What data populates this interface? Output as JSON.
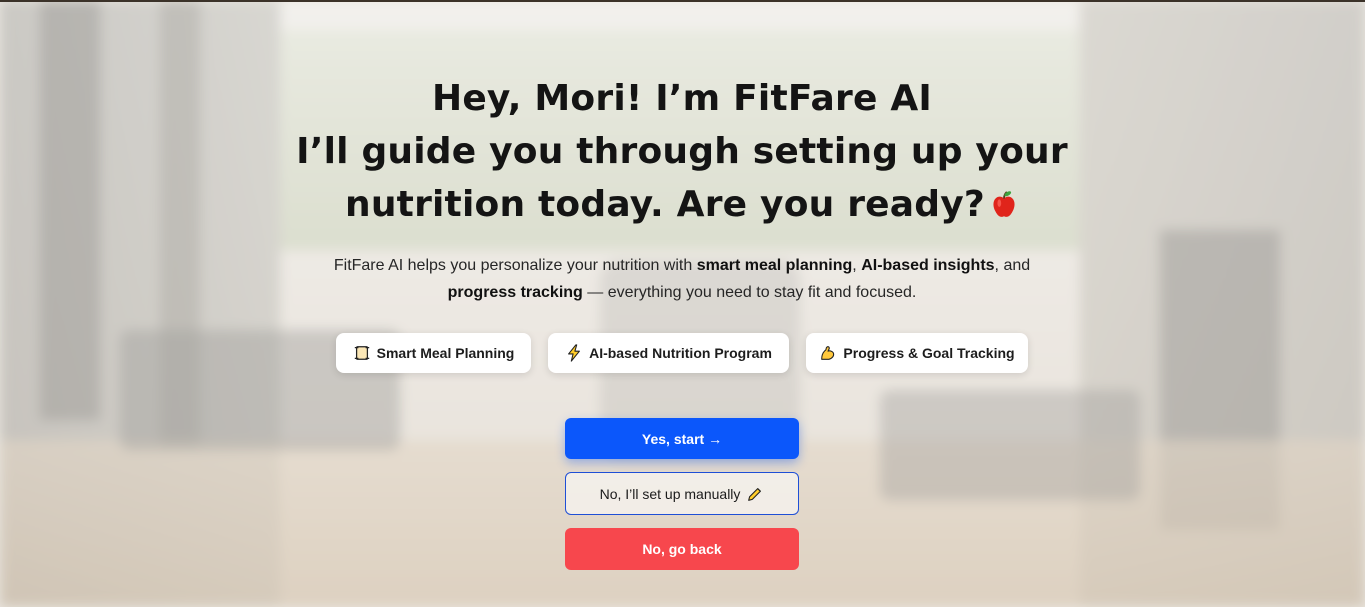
{
  "header": {
    "line1": "Hey, Mori! I’m FitFare AI",
    "line2": "I’ll guide you through setting up your",
    "line3": "nutrition today. Are you ready?",
    "emoji_icon": "apple-icon"
  },
  "description": {
    "part1": "FitFare AI helps you personalize your nutrition with ",
    "bold1": "smart meal planning",
    "sep1": ", ",
    "bold2": "AI-based insights",
    "sep2": ", and",
    "bold3": "progress tracking",
    "part2": " — everything you need to stay fit and focused."
  },
  "features": [
    {
      "label": "Smart Meal Planning",
      "icon": "scroll-icon"
    },
    {
      "label": "AI-based Nutrition Program",
      "icon": "lightning-icon"
    },
    {
      "label": "Progress & Goal Tracking",
      "icon": "flexed-bicep-icon"
    }
  ],
  "actions": {
    "start_label": "Yes, start →",
    "manual_label": "No, I’ll set up manually",
    "manual_icon": "pencil-icon",
    "back_label": "No, go back"
  },
  "colors": {
    "primary": "#0b57fb",
    "danger": "#f7474d",
    "outline": "#1f4fd6"
  }
}
